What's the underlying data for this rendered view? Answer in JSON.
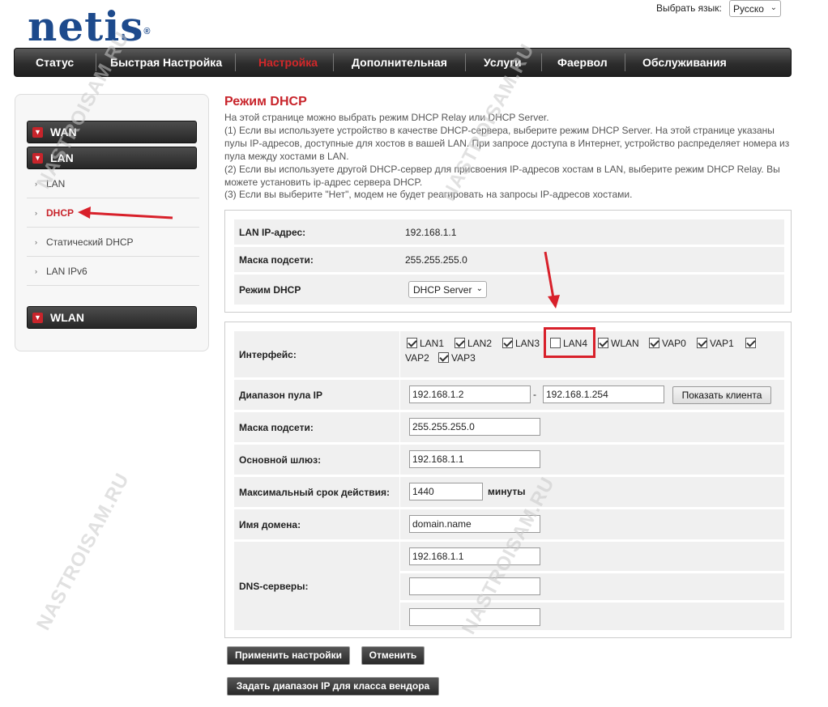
{
  "header": {
    "logo_text": "netis",
    "logo_mark": "®",
    "lang_label": "Выбрать язык:",
    "lang_value": "Русско"
  },
  "topnav": [
    {
      "label": "Статус"
    },
    {
      "label": "Быстрая Настройка"
    },
    {
      "label": "Настройка",
      "active": true
    },
    {
      "label": "Дополнительная"
    },
    {
      "label": "Услуги"
    },
    {
      "label": "Фаервол"
    },
    {
      "label": "Обслуживания"
    }
  ],
  "sidebar": {
    "groups": {
      "wan": "WAN",
      "lan": "LAN",
      "wlan": "WLAN"
    },
    "items": [
      {
        "label": "LAN"
      },
      {
        "label": "DHCP",
        "active": true
      },
      {
        "label": "Статический DHCP"
      },
      {
        "label": "LAN IPv6"
      }
    ]
  },
  "main": {
    "title": "Режим DHCP",
    "description": [
      "На этой странице можно выбрать режим DHCP Relay или DHCP Server.",
      "(1) Если вы используете устройство в качестве DHCP-сервера, выберите режим DHCP Server. На этой странице указаны",
      "пулы IP-адресов, доступные для хостов в вашей LAN. При запросе доступа в Интернет, устройство распределяет номера из",
      "пула между хостами в LAN.",
      "(2) Если вы используете другой DHCP-сервер для присвоения IP-адресов хостам в LAN, выберите режим DHCP Relay. Вы",
      "можете установить ip-адрес сервера DHCP.",
      "(3) Если вы выберите \"Нет\", модем не будет реагировать на запросы IP-адресов хостами."
    ],
    "info": {
      "lan_ip_label": "LAN IP-адрес:",
      "lan_ip_value": "192.168.1.1",
      "mask_label": "Маска подсети:",
      "mask_value": "255.255.255.0",
      "mode_label": "Режим DHCP",
      "mode_value": "DHCP Server"
    },
    "server": {
      "interface_label": "Интерфейс:",
      "interfaces": [
        {
          "name": "LAN1",
          "checked": true
        },
        {
          "name": "LAN2",
          "checked": true
        },
        {
          "name": "LAN3",
          "checked": true
        },
        {
          "name": "LAN4",
          "checked": false
        },
        {
          "name": "WLAN",
          "checked": true
        },
        {
          "name": "VAP0",
          "checked": true
        },
        {
          "name": "VAP1",
          "checked": true
        },
        {
          "name": "VAP2",
          "checked": true
        },
        {
          "name": "VAP3",
          "checked": true
        }
      ],
      "pool_label": "Диапазон пула IP",
      "pool_start": "192.168.1.2",
      "pool_dash": "-",
      "pool_end": "192.168.1.254",
      "show_clients_button": "Показать клиента",
      "mask_label": "Маска подсети:",
      "mask_value": "255.255.255.0",
      "gateway_label": "Основной шлюз:",
      "gateway_value": "192.168.1.1",
      "lease_label": "Максимальный срок действия:",
      "lease_value": "1440",
      "lease_unit": "минуты",
      "domain_label": "Имя домена:",
      "domain_value": "domain.name",
      "dns_label": "DNS-серверы:",
      "dns_values": [
        "192.168.1.1",
        "",
        ""
      ]
    },
    "buttons": {
      "apply": "Применить настройки",
      "cancel": "Отменить",
      "vendor_range": "Задать диапазон IP для класса вендора"
    }
  },
  "watermark": "NASTROISAM.RU",
  "colors": {
    "accent_red": "#c8242b",
    "logo_blue": "#1d4a8c",
    "nav_dark": "#2d2d2d"
  }
}
